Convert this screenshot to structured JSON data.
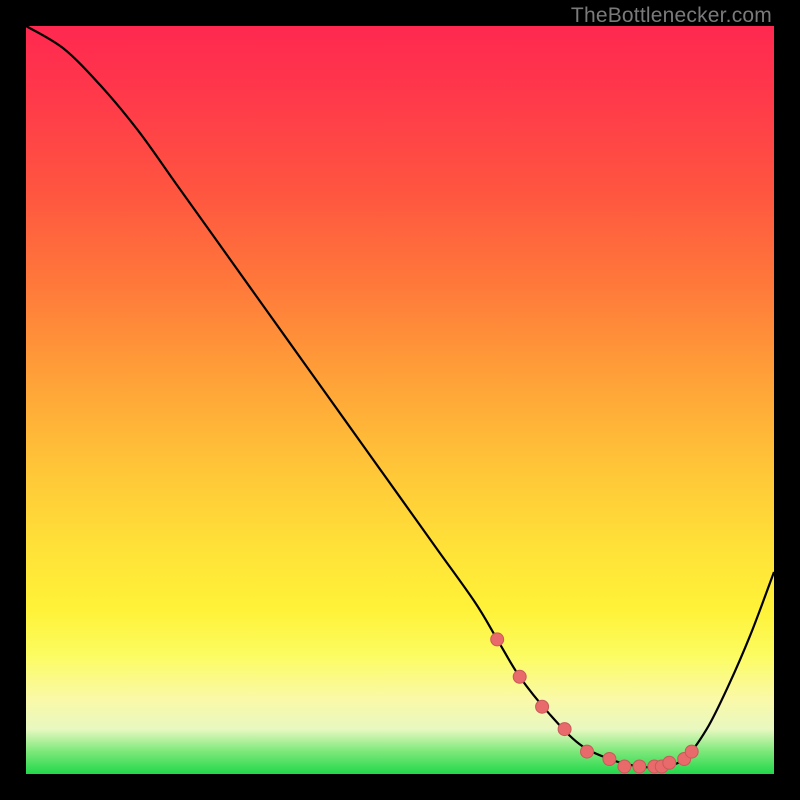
{
  "watermark": "TheBottlenecker.com",
  "colors": {
    "frame": "#000000",
    "curve": "#000000",
    "marker": "#e86a6a",
    "marker_stroke": "#c85a5a"
  },
  "chart_data": {
    "type": "line",
    "title": "",
    "xlabel": "",
    "ylabel": "",
    "xlim": [
      0,
      100
    ],
    "ylim": [
      0,
      100
    ],
    "series": [
      {
        "name": "bottleneck-curve",
        "x": [
          0,
          5,
          10,
          15,
          20,
          25,
          30,
          35,
          40,
          45,
          50,
          55,
          60,
          63,
          66,
          70,
          74,
          78,
          82,
          85,
          88,
          91,
          94,
          97,
          100
        ],
        "y": [
          100,
          97,
          92,
          86,
          79,
          72,
          65,
          58,
          51,
          44,
          37,
          30,
          23,
          18,
          13,
          8,
          4,
          2,
          1,
          1,
          2,
          6,
          12,
          19,
          27
        ]
      }
    ],
    "markers": {
      "name": "highlighted-range",
      "x": [
        63,
        66,
        69,
        72,
        75,
        78,
        80,
        82,
        84,
        85,
        86,
        88,
        89
      ],
      "y": [
        18,
        13,
        9,
        6,
        3,
        2,
        1,
        1,
        1,
        1,
        1.5,
        2,
        3
      ]
    }
  }
}
